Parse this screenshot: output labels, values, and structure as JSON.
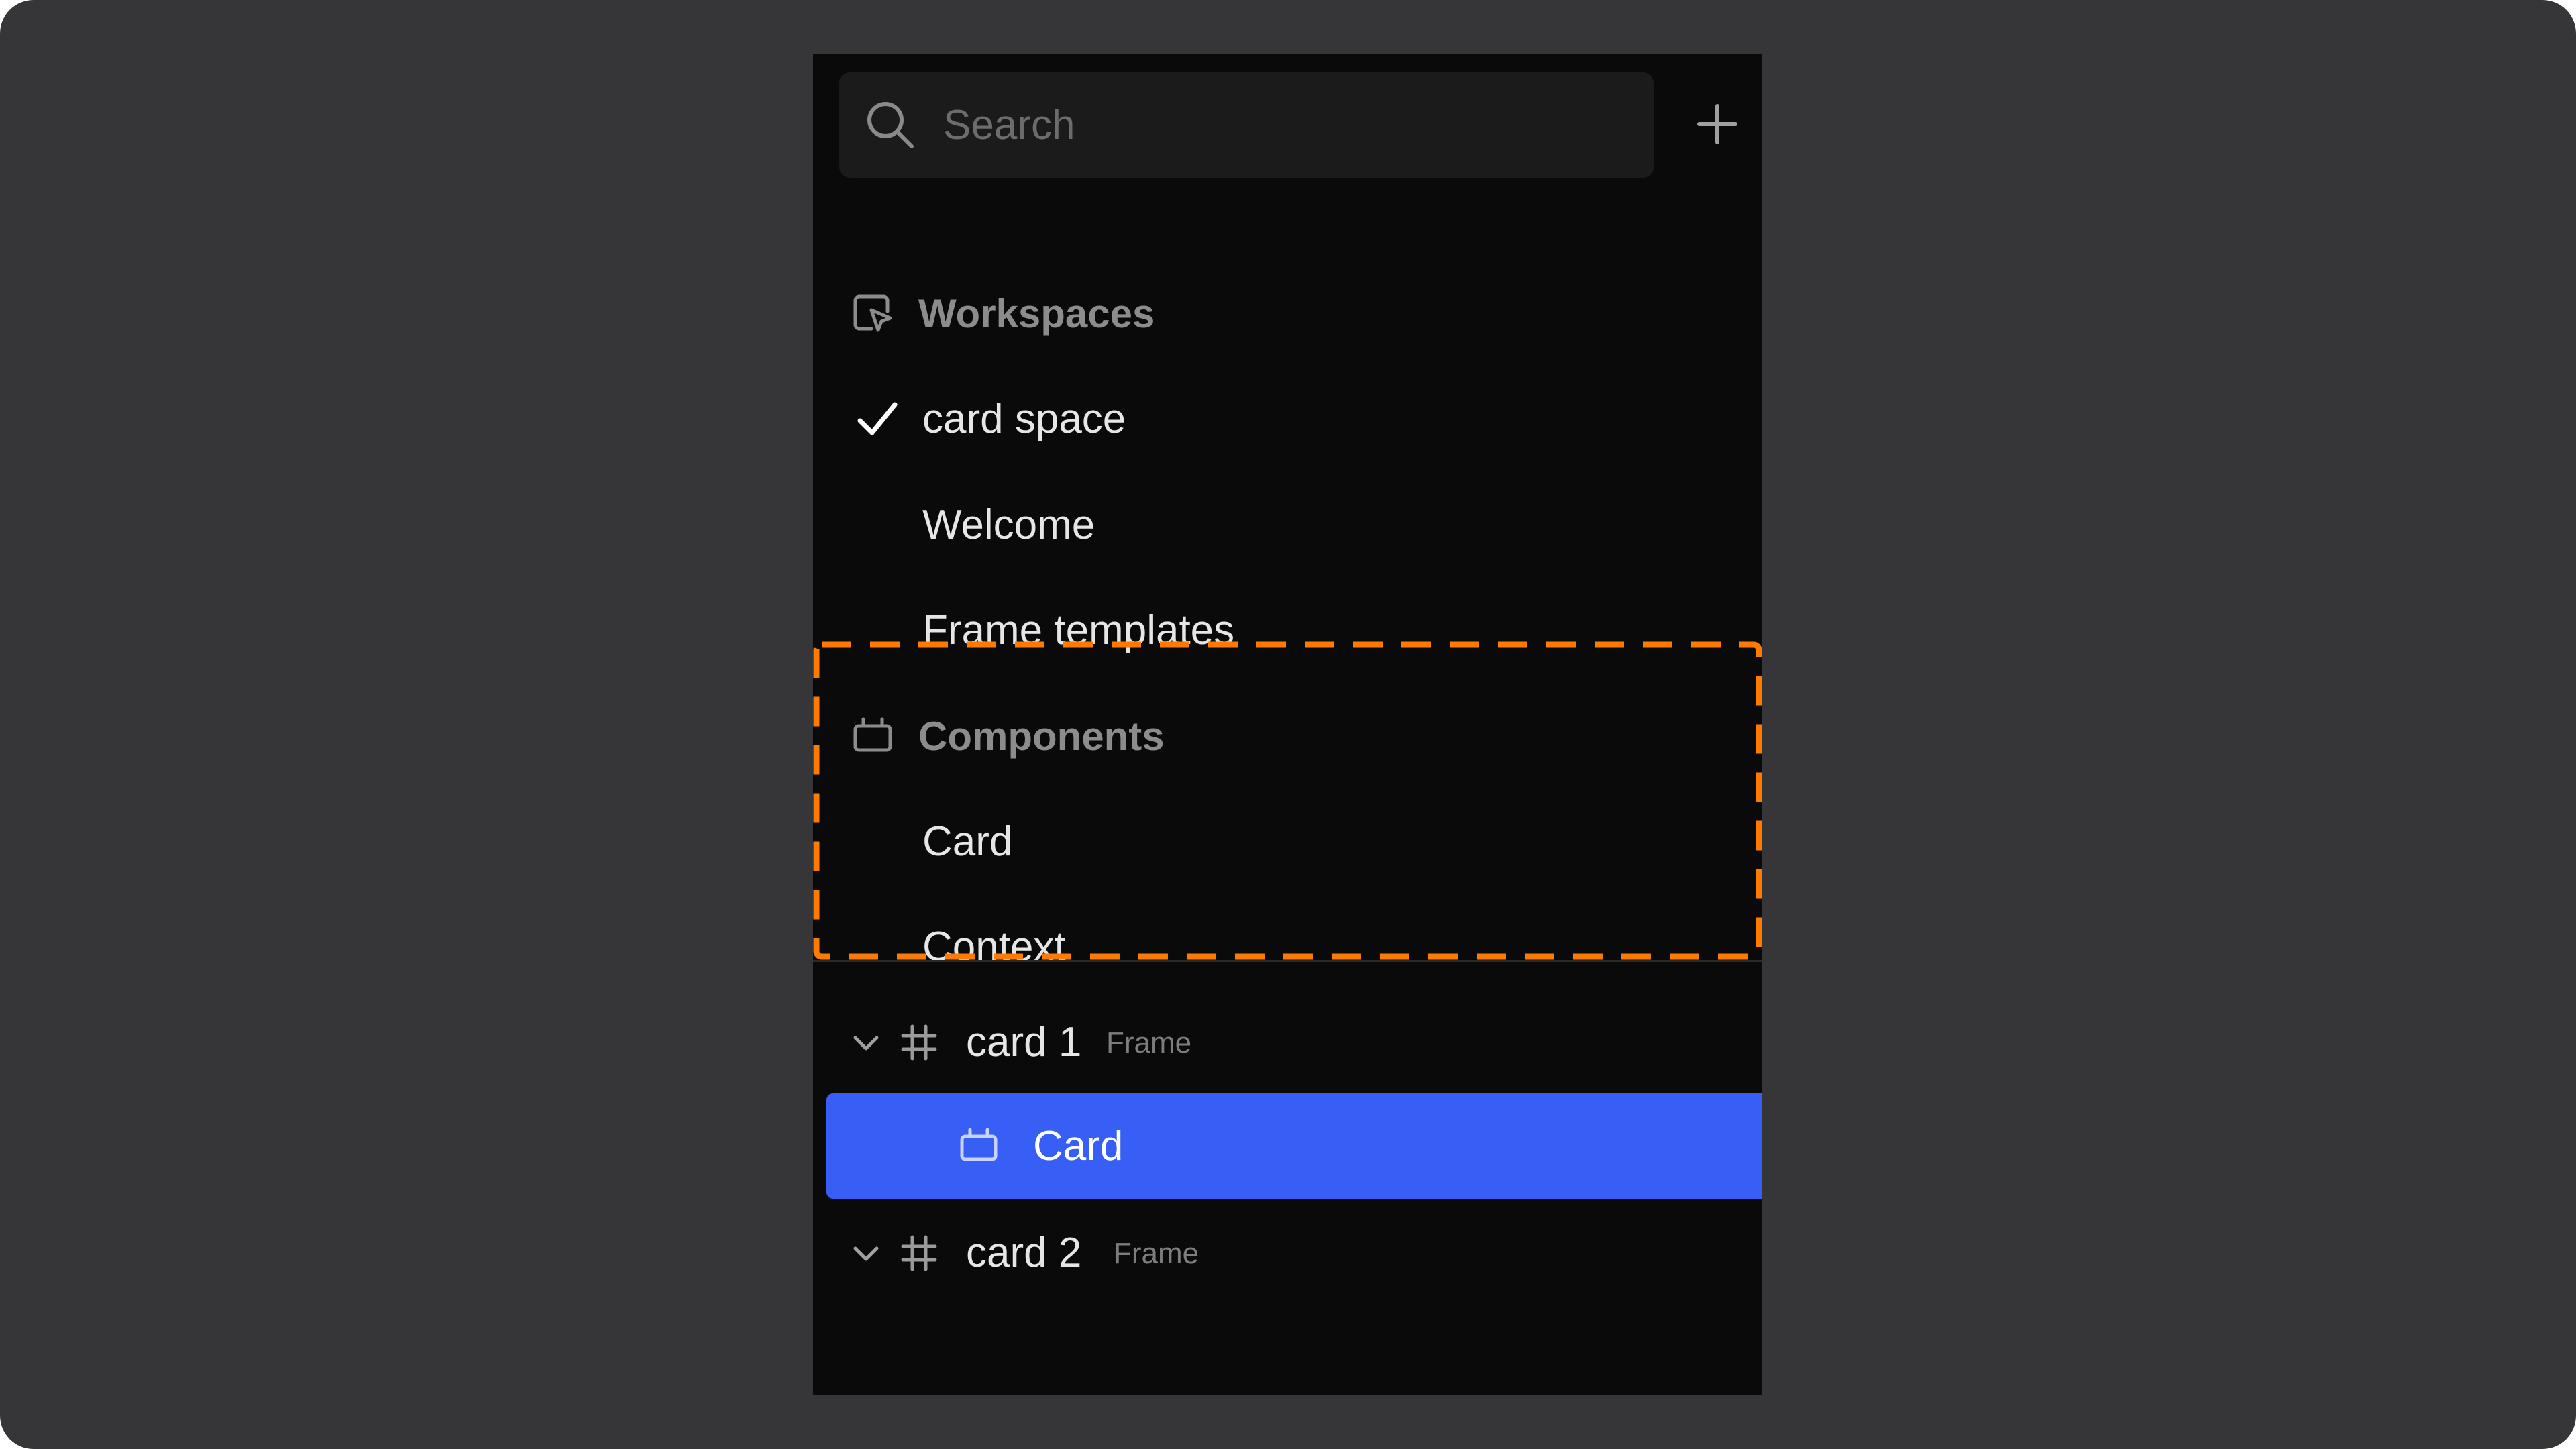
{
  "search": {
    "placeholder": "Search"
  },
  "workspaces": {
    "header": "Workspaces",
    "items": [
      {
        "label": "card space",
        "checked": true
      },
      {
        "label": "Welcome",
        "checked": false
      },
      {
        "label": "Frame templates",
        "checked": false
      }
    ]
  },
  "components": {
    "header": "Components",
    "items": [
      {
        "label": "Card"
      },
      {
        "label": "Context"
      }
    ]
  },
  "layers": [
    {
      "name": "card 1",
      "type": "Frame",
      "expanded": true
    },
    {
      "name": "Card",
      "type": "",
      "selected": true
    },
    {
      "name": "card 2",
      "type": "Frame",
      "expanded": true
    }
  ],
  "colors": {
    "background": "#363638",
    "panel": "#0a0a0a",
    "search_field": "#1b1b1b",
    "highlight_dash": "#ff7a00",
    "selected_row": "#375ef5"
  },
  "icons": {
    "search": "search-icon",
    "add": "plus-icon",
    "workspaces": "workspace-cursor-icon",
    "check": "check-icon",
    "components": "component-icon",
    "chevron": "chevron-down-icon",
    "frame": "hash-icon"
  }
}
